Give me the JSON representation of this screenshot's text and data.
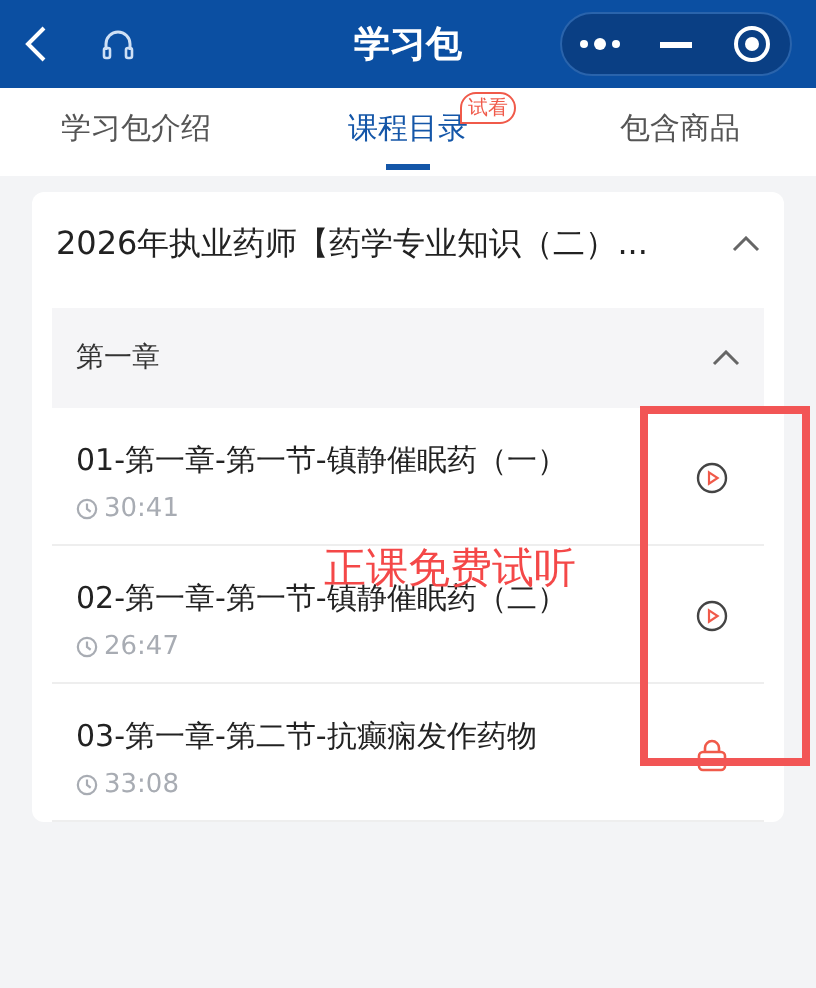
{
  "nav_bar": {
    "title": "学习包"
  },
  "tabs": [
    {
      "label": "学习包介绍",
      "selected": false
    },
    {
      "label": "课程目录",
      "selected": true,
      "badge": "试看"
    },
    {
      "label": "包含商品",
      "selected": false
    }
  ],
  "course": {
    "title": "2026年执业药师【药学专业知识（二）...",
    "expanded": true,
    "chapter": {
      "title": "第一章",
      "expanded": true,
      "lessons": [
        {
          "title": "01-第一章-第一节-镇静催眠药（一）",
          "duration": "30:41",
          "kind": "play"
        },
        {
          "title": "02-第一章-第一节-镇静催眠药（二）",
          "duration": "26:47",
          "kind": "play"
        },
        {
          "title": "03-第一章-第二节-抗癫痫发作药物",
          "duration": "33:08",
          "kind": "locked"
        }
      ]
    }
  },
  "annotation": {
    "text": "正课免费试听"
  }
}
